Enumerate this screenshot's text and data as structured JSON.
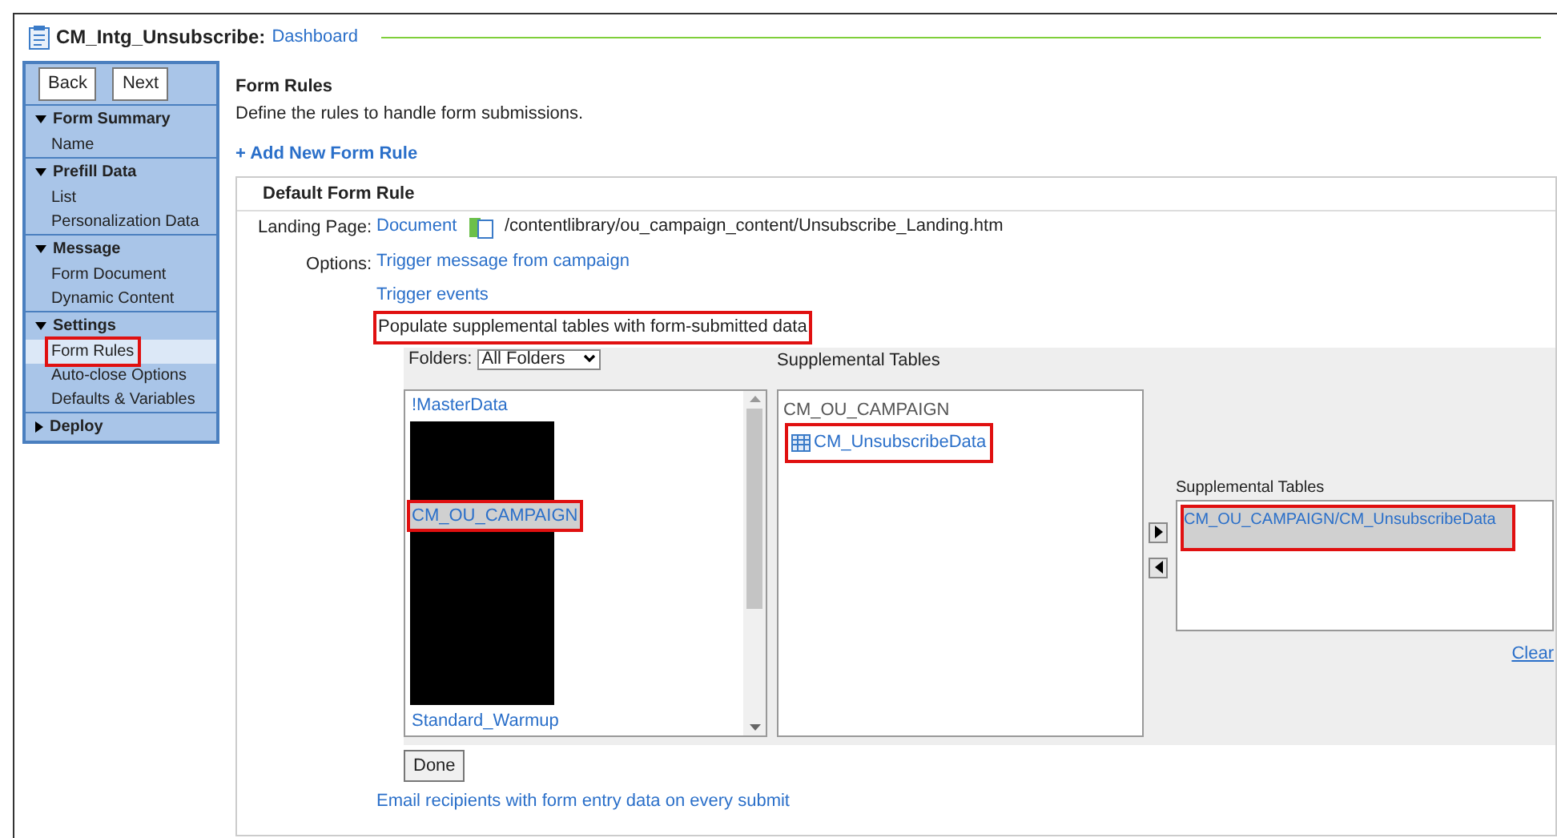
{
  "header": {
    "title": "CM_Intg_Unsubscribe:",
    "link": "Dashboard"
  },
  "sidebar": {
    "buttons": [
      "Back",
      "Next"
    ],
    "sections": [
      {
        "label": "Form Summary",
        "expanded": true,
        "items": [
          {
            "label": "Name",
            "selected": false,
            "highlighted": false
          }
        ]
      },
      {
        "label": "Prefill Data",
        "expanded": true,
        "items": [
          {
            "label": "List",
            "selected": false,
            "highlighted": false
          },
          {
            "label": "Personalization Data",
            "selected": false,
            "highlighted": false
          }
        ]
      },
      {
        "label": "Message",
        "expanded": true,
        "items": [
          {
            "label": "Form Document",
            "selected": false,
            "highlighted": false
          },
          {
            "label": "Dynamic Content",
            "selected": false,
            "highlighted": false
          }
        ]
      },
      {
        "label": "Settings",
        "expanded": true,
        "items": [
          {
            "label": "Form Rules",
            "selected": true,
            "highlighted": true
          },
          {
            "label": "Auto-close Options",
            "selected": false,
            "highlighted": false
          },
          {
            "label": "Defaults & Variables",
            "selected": false,
            "highlighted": false
          }
        ]
      },
      {
        "label": "Deploy",
        "expanded": false
      }
    ]
  },
  "main": {
    "title": "Form Rules",
    "description": "Define the rules to handle form submissions.",
    "add_link": "+ Add New Form Rule",
    "rule": {
      "title": "Default Form Rule",
      "landing_label": "Landing Page:",
      "landing_link": "Document",
      "landing_path": "/contentlibrary/ou_campaign_content/Unsubscribe_Landing.htm",
      "options_label": "Options:",
      "options": [
        {
          "label": "Trigger message from campaign",
          "kind": "link",
          "highlighted": false
        },
        {
          "label": "Trigger events",
          "kind": "link",
          "highlighted": false
        },
        {
          "label": "Populate supplemental tables with form-submitted data",
          "kind": "text",
          "highlighted": true
        }
      ],
      "picker": {
        "folders_label": "Folders:",
        "folder_select": "All Folders",
        "folders": [
          {
            "kind": "folder",
            "label": "!MasterData",
            "selected": false,
            "highlighted": false
          },
          {
            "kind": "redacted"
          },
          {
            "kind": "folder",
            "label": "CM_OU_CAMPAIGN",
            "selected": true,
            "highlighted": true
          },
          {
            "kind": "redacted"
          },
          {
            "kind": "folder",
            "label": "Standard_Warmup",
            "selected": false,
            "highlighted": false
          }
        ],
        "tables_heading": "Supplemental Tables",
        "table_group": "CM_OU_CAMPAIGN",
        "tables": [
          {
            "label": "CM_UnsubscribeData",
            "highlighted": true
          }
        ],
        "selected_heading": "Supplemental Tables",
        "selected_tables": [
          {
            "label": "CM_OU_CAMPAIGN/CM_UnsubscribeData",
            "selected": true,
            "highlighted": true
          }
        ],
        "clear": "Clear"
      },
      "done": "Done",
      "email_link": "Email recipients with form entry data on every submit"
    }
  }
}
